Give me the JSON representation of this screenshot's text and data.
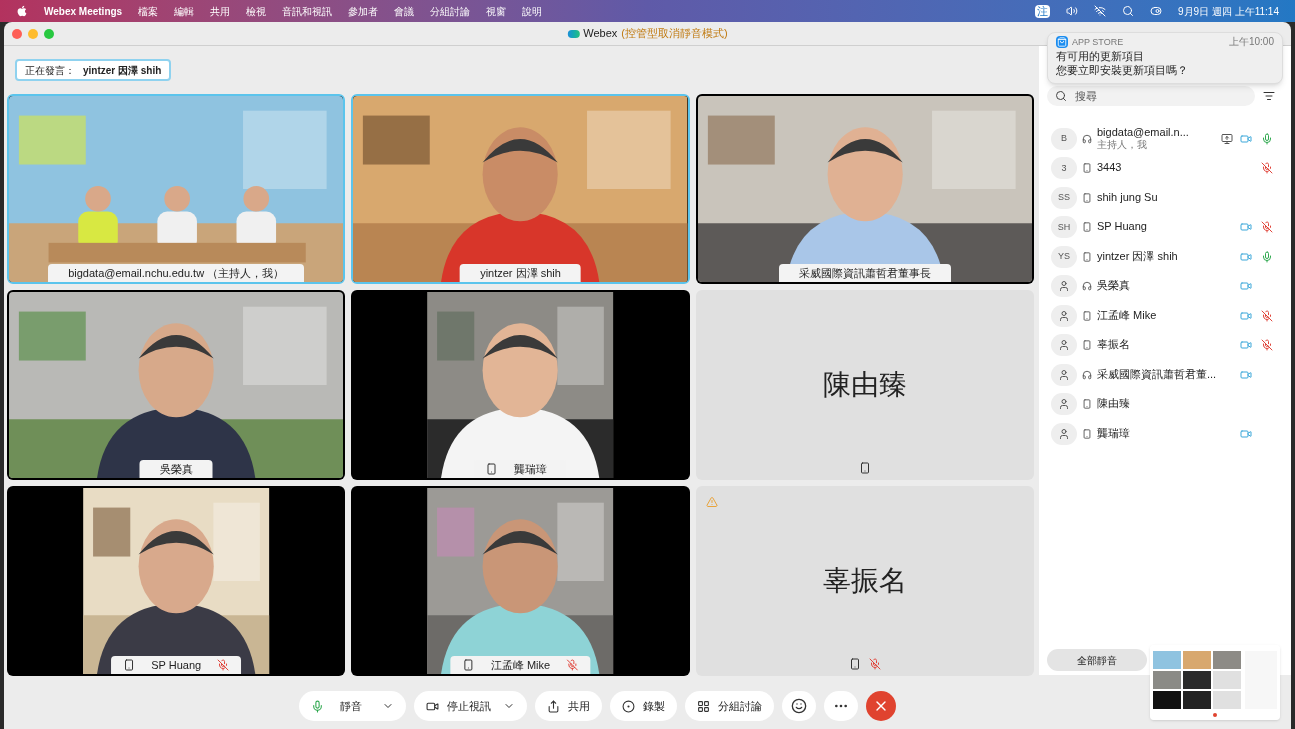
{
  "menu_bar": {
    "app_name": "Webex Meetings",
    "menus": [
      "檔案",
      "編輯",
      "共用",
      "檢視",
      "音訊和視訊",
      "參加者",
      "會議",
      "分組討論",
      "視窗",
      "說明"
    ],
    "input_method": "注",
    "clock": "9月9日 週四 上午11:14"
  },
  "window": {
    "title": "Webex",
    "mode": "(控管型取消靜音模式)"
  },
  "speaking": {
    "label": "正在發言：",
    "name": "yintzer 因澤 shih"
  },
  "tiles": [
    {
      "kind": "video",
      "name": "bigdata@email.nchu.edu.tw （主持人，我）",
      "highlighted": true,
      "phone": false,
      "muted": false,
      "letterbox": false
    },
    {
      "kind": "video",
      "name": "yintzer 因澤 shih",
      "highlighted": true,
      "phone": false,
      "muted": false,
      "letterbox": false
    },
    {
      "kind": "video",
      "name": "采威國際資訊蕭哲君董事長",
      "highlighted": false,
      "phone": false,
      "muted": false,
      "letterbox": false
    },
    {
      "kind": "video",
      "name": "吳榮真",
      "highlighted": false,
      "phone": false,
      "muted": false,
      "letterbox": false
    },
    {
      "kind": "video",
      "name": "龔瑞璋",
      "highlighted": false,
      "phone": true,
      "muted": false,
      "letterbox": true
    },
    {
      "kind": "avatar",
      "name": "陳由臻",
      "highlighted": false,
      "phone": true,
      "muted": false,
      "warning": false
    },
    {
      "kind": "video",
      "name": "SP Huang",
      "highlighted": false,
      "phone": true,
      "muted": true,
      "letterbox": true
    },
    {
      "kind": "video",
      "name": "江孟峰 Mike",
      "highlighted": false,
      "phone": true,
      "muted": true,
      "letterbox": true
    },
    {
      "kind": "avatar",
      "name": "辜振名",
      "highlighted": false,
      "phone": true,
      "muted": true,
      "warning": true
    }
  ],
  "notification": {
    "app": "APP STORE",
    "time": "上午10:00",
    "title": "有可用的更新項目",
    "body": "您要立即安裝更新項目嗎？"
  },
  "participants_panel": {
    "search": {
      "placeholder": "搜尋"
    },
    "mute_all": "全部靜音",
    "participants": [
      {
        "initials": "B",
        "name": "bigdata@email.n...",
        "subtitle": "主持人，我",
        "phone": false,
        "sharing": true,
        "camera": true,
        "mic": true,
        "muted": false
      },
      {
        "initials": "3",
        "name": "3443",
        "phone": true,
        "sharing": false,
        "camera": false,
        "mic": true,
        "muted": true
      },
      {
        "initials": "SS",
        "name": "shih jung Su",
        "phone": true,
        "sharing": false,
        "camera": false,
        "mic": false
      },
      {
        "initials": "SH",
        "name": "SP Huang",
        "phone": true,
        "sharing": false,
        "camera": true,
        "mic": true,
        "muted": true
      },
      {
        "initials": "YS",
        "name": "yintzer 因澤 shih",
        "phone": true,
        "sharing": false,
        "camera": true,
        "mic": true,
        "muted": false
      },
      {
        "name": "吳榮真",
        "phone": false,
        "sharing": false,
        "camera": true,
        "mic": false
      },
      {
        "name": "江孟峰 Mike",
        "phone": true,
        "sharing": false,
        "camera": true,
        "mic": true,
        "muted": true
      },
      {
        "name": "辜振名",
        "phone": true,
        "sharing": false,
        "camera": true,
        "mic": true,
        "muted": true
      },
      {
        "name": "采威國際資訊蕭哲君董...",
        "phone": false,
        "sharing": false,
        "camera": true,
        "mic": false
      },
      {
        "name": "陳由臻",
        "phone": true,
        "sharing": false,
        "camera": false,
        "mic": false
      },
      {
        "name": "龔瑞璋",
        "phone": true,
        "sharing": false,
        "camera": true,
        "mic": false
      }
    ]
  },
  "toolbar": [
    {
      "kind": "mute",
      "label": "靜音",
      "dropdown": true
    },
    {
      "kind": "video",
      "label": "停止視訊",
      "dropdown": true
    },
    {
      "kind": "share",
      "label": "共用"
    },
    {
      "kind": "record",
      "label": "錄製"
    },
    {
      "kind": "breakout",
      "label": "分組討論"
    },
    {
      "kind": "reactions"
    },
    {
      "kind": "more"
    },
    {
      "kind": "leave"
    }
  ]
}
